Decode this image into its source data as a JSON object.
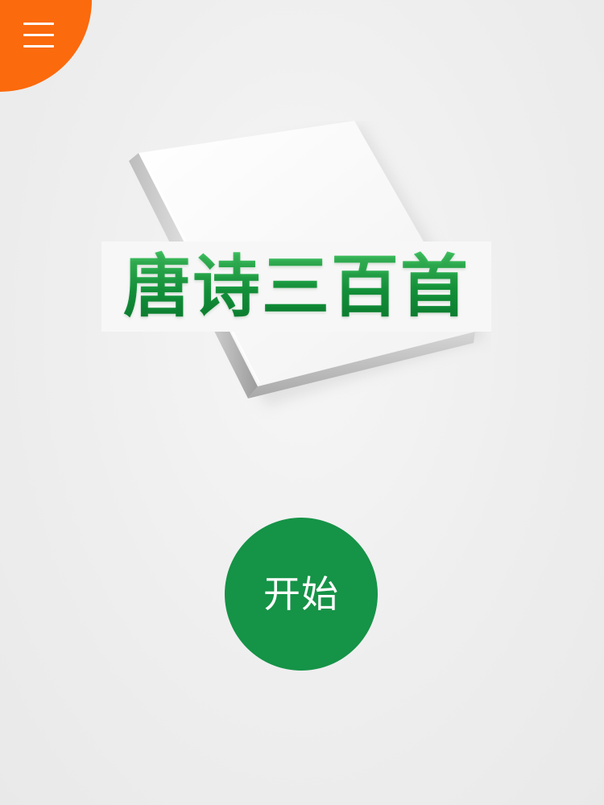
{
  "menu": {
    "icon": "hamburger-menu-icon",
    "color": "#fb6a0c"
  },
  "cover": {
    "title": "唐诗三百首",
    "title_color": "#1b9a43"
  },
  "start": {
    "label": "开始",
    "color": "#159347"
  }
}
